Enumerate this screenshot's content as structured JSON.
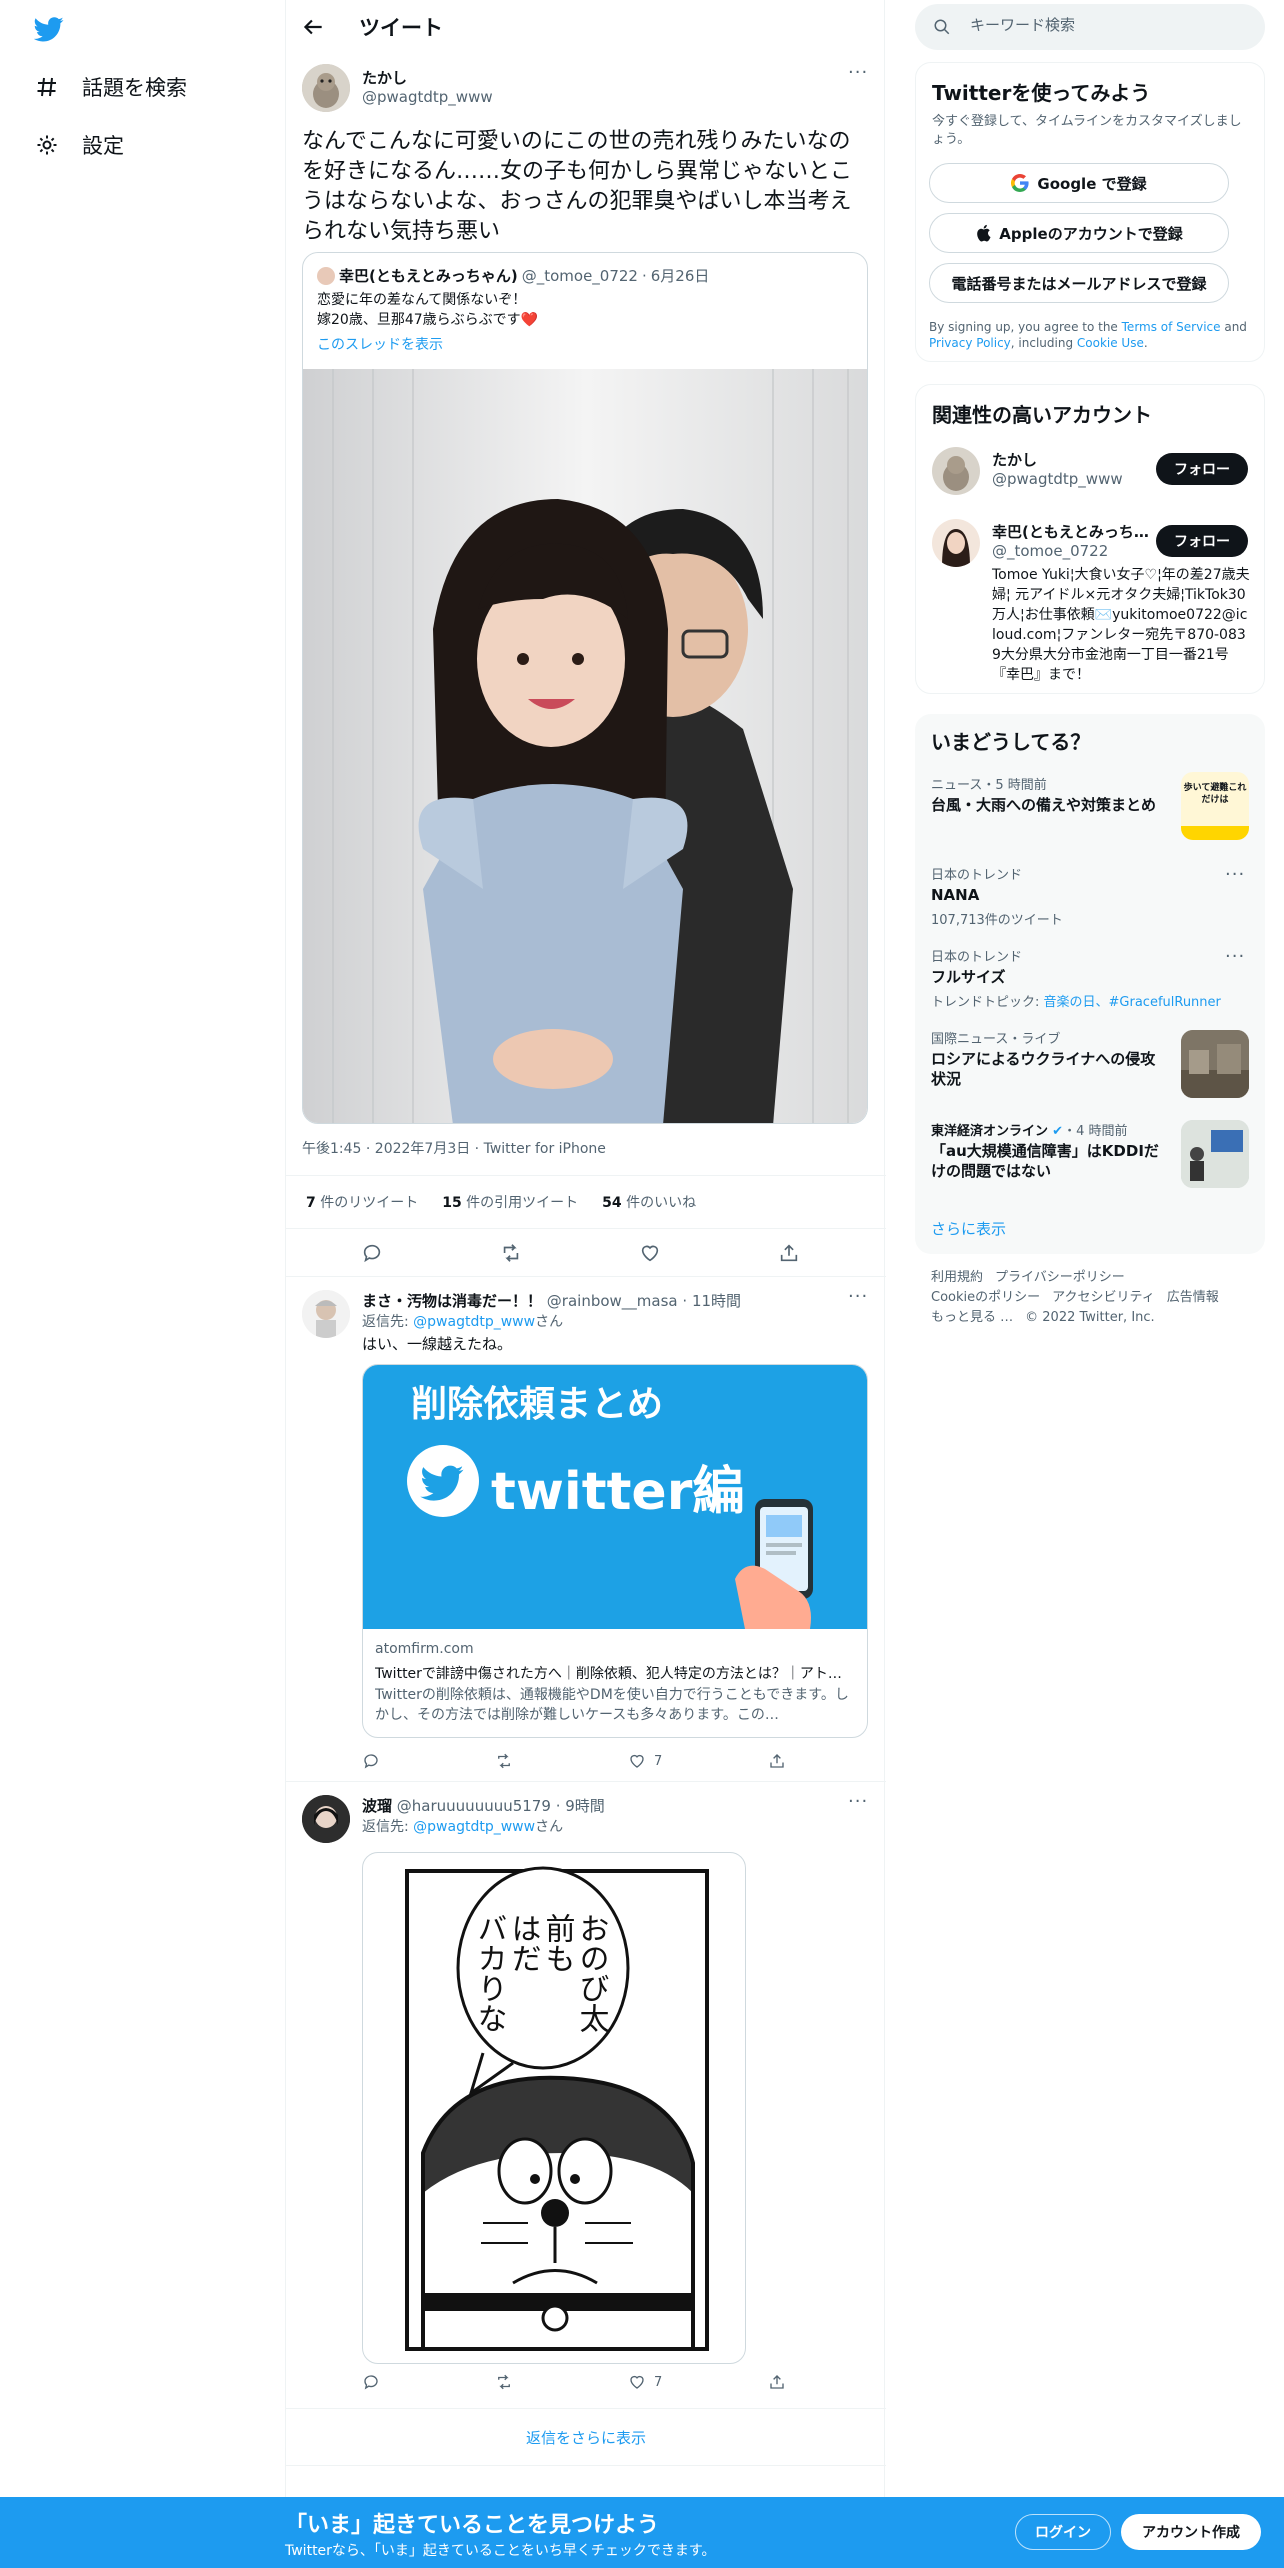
{
  "nav": {
    "explore_label": "話題を検索",
    "settings_label": "設定"
  },
  "header": {
    "title": "ツイート"
  },
  "tweet": {
    "name": "たかし",
    "handle": "@pwagtdtp_www",
    "text": "なんでこんなに可愛いのにこの世の売れ残りみたいなのを好きになるん……女の子も何かしら異常じゃないとこうはならないよな、おっさんの犯罪臭やばいし本当考えられない気持ち悪い",
    "quote": {
      "name": "幸巴(ともえとみっちゃん)",
      "handle": "@_tomoe_0722",
      "date": "6月26日",
      "line1": "恋愛に年の差なんて関係ないぞ！",
      "line2": "嫁20歳、旦那47歳らぶらぶです❤️",
      "thread_link": "このスレッドを表示"
    },
    "meta": "午後1:45 · 2022年7月3日 · Twitter for iPhone",
    "retweets_count": "7",
    "retweets_label": "件のリツイート",
    "quotes_count": "15",
    "quotes_label": "件の引用ツイート",
    "likes_count": "54",
    "likes_label": "件のいいね"
  },
  "replies": [
    {
      "name": "まさ・汚物は消毒だー！！",
      "handle": "@rainbow__masa",
      "time": "11時間",
      "reply_to_prefix": "返信先: ",
      "reply_to_handle": "@pwagtdtp_www",
      "reply_to_suffix": "さん",
      "text": "はい、一線越えたね。",
      "card": {
        "banner_title": "削除依頼まとめ",
        "banner_brand": "twitter編",
        "domain": "atomfirm.com",
        "title": "Twitterで誹謗中傷された方へ｜削除依頼、犯人特定の方法とは？｜アトム法律事務所",
        "desc": "Twitterの削除依頼は、通報機能やDMを使い自力で行うこともできます。しかし、その方法では削除が難しいケースも多々あります。この…"
      },
      "likes": "7"
    },
    {
      "name": "波瑠",
      "handle": "@haruuuuuuuu5179",
      "time": "9時間",
      "reply_to_prefix": "返信先: ",
      "reply_to_handle": "@pwagtdtp_www",
      "reply_to_suffix": "さん",
      "manga_text_1": "おのび太",
      "manga_text_2": "前も",
      "manga_text_3": "はだ",
      "manga_text_4": "バカりな",
      "likes": "7"
    }
  ],
  "show_more_replies": "返信をさらに表示",
  "search": {
    "placeholder": "キーワード検索"
  },
  "signup_panel": {
    "title": "Twitterを使ってみよう",
    "subtitle": "今すぐ登録して、タイムラインをカスタマイズしましょう。",
    "google_btn": "Google で登録",
    "apple_btn": "Appleのアカウントで登録",
    "phone_btn": "電話番号またはメールアドレスで登録",
    "terms_1": "By signing up, you agree to the ",
    "terms_link1": "Terms of Service",
    "terms_2": " and ",
    "terms_link2": "Privacy Policy",
    "terms_3": ", including ",
    "terms_link3": "Cookie Use",
    "terms_4": "."
  },
  "related_panel": {
    "title": "関連性の高いアカウント",
    "follow_label": "フォロー",
    "accounts": [
      {
        "name": "たかし",
        "handle": "@pwagtdtp_www",
        "bio": ""
      },
      {
        "name": "幸巴(ともえとみっち…",
        "handle": "@_tomoe_0722",
        "bio": "Tomoe Yuki¦大食い女子♡¦年の差27歳夫婦¦ 元アイドル×元オタク夫婦¦TikTok30万人¦お仕事依頼✉️yukitomoe0722@icloud.com¦ファンレター宛先〒870-0839大分県大分市金池南一丁目一番21号『幸巴』まで！"
      }
    ]
  },
  "trends_panel": {
    "title": "いまどうしてる？",
    "items": [
      {
        "context": "ニュース・5 時間前",
        "title": "台風・大雨への備えや対策まとめ",
        "count": "",
        "thumb": "歩いて避難これだけは"
      },
      {
        "context": "日本のトレンド",
        "title": "NANA",
        "count": "107,713件のツイート"
      },
      {
        "context": "日本のトレンド",
        "title": "フルサイズ",
        "count_prefix": "トレンドトピック: ",
        "count_link": "音楽の日、#GracefulRunner"
      },
      {
        "context": "国際ニュース・ライブ",
        "title": "ロシアによるウクライナへの侵攻状況"
      },
      {
        "context_source": "東洋経済オンライン",
        "context_time": "・4 時間前",
        "title": "「au大規模通信障害」はKDDIだけの問題ではない"
      }
    ],
    "show_more": "さらに表示"
  },
  "footer": {
    "links": [
      "利用規約",
      "プライバシーポリシー",
      "Cookieのポリシー",
      "アクセシビリティ",
      "広告情報",
      "もっと見る …",
      "© 2022 Twitter, Inc."
    ]
  },
  "bottombar": {
    "title": "「いま」起きていることを見つけよう",
    "subtitle": "Twitterなら、「いま」起きていることをいち早くチェックできます。",
    "login": "ログイン",
    "signup": "アカウント作成"
  },
  "colors": {
    "accent": "#1d9bf0",
    "text": "#0f1419",
    "muted": "#536471"
  }
}
